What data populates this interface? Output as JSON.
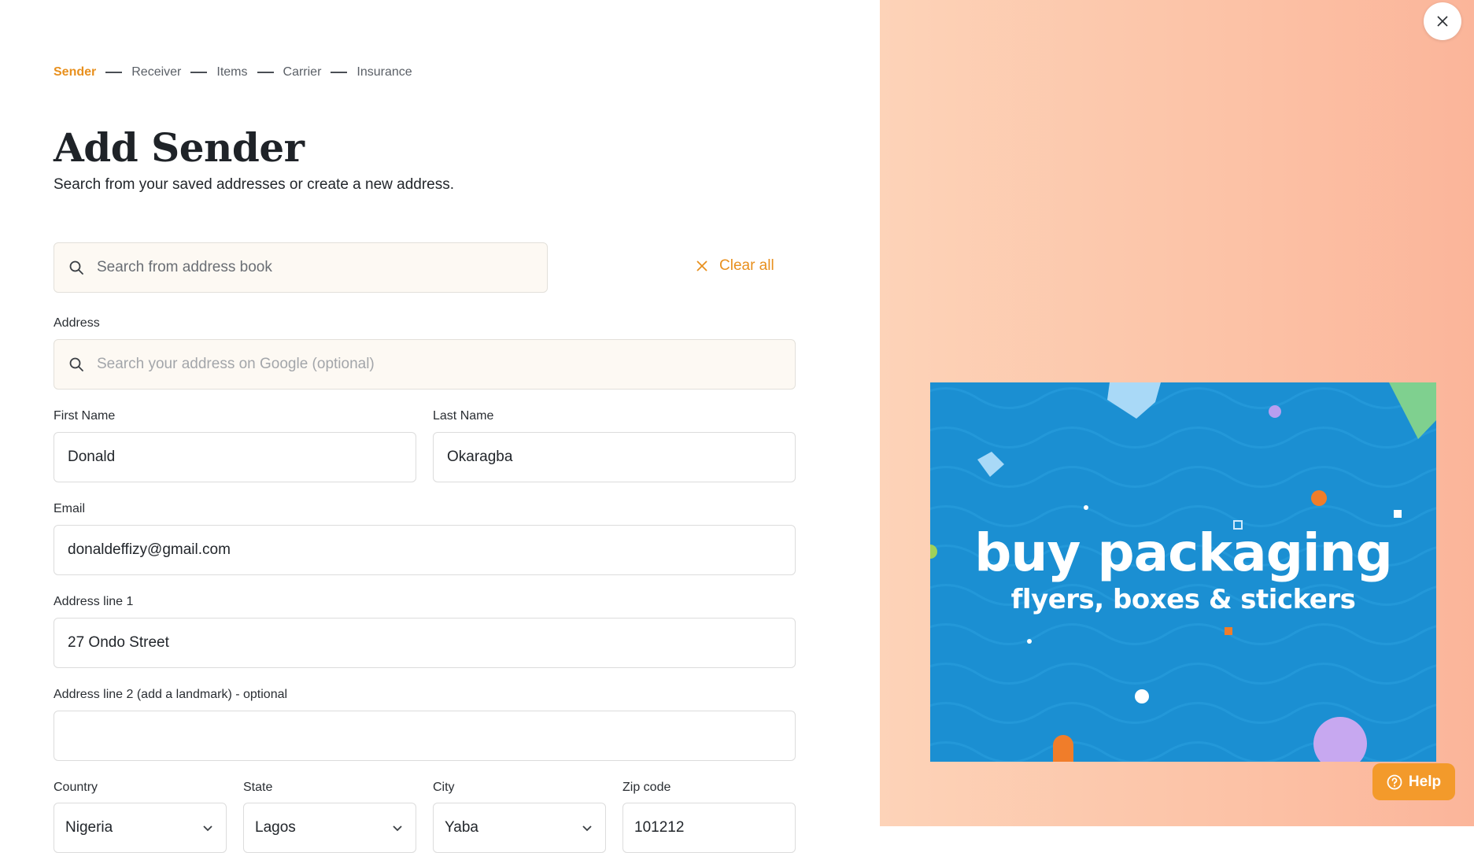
{
  "steps": [
    "Sender",
    "Receiver",
    "Items",
    "Carrier",
    "Insurance"
  ],
  "page": {
    "title": "Add Sender",
    "subtitle": "Search from your saved addresses or create a new address."
  },
  "address_book": {
    "placeholder": "Search from address book"
  },
  "clear_all_label": "Clear all",
  "form": {
    "address_label": "Address",
    "address_placeholder": "Search your address on Google (optional)",
    "first_name_label": "First Name",
    "first_name": "Donald",
    "last_name_label": "Last Name",
    "last_name": "Okaragba",
    "email_label": "Email",
    "email": "donaldeffizy@gmail.com",
    "address1_label": "Address line 1",
    "address1": "27 Ondo Street",
    "address2_label": "Address line 2 (add a landmark) - optional",
    "address2": "",
    "country_label": "Country",
    "country": "Nigeria",
    "state_label": "State",
    "state": "Lagos",
    "city_label": "City",
    "city": "Yaba",
    "zip_label": "Zip code",
    "zip": "101212"
  },
  "banner": {
    "title": "buy packaging",
    "subtitle": "flyers, boxes & stickers"
  },
  "help_label": "Help",
  "colors": {
    "accent": "#e8901e",
    "help_button": "#f39a2b",
    "banner_blue": "#1b8fd2",
    "panel_peach": "#fcc2a6"
  }
}
